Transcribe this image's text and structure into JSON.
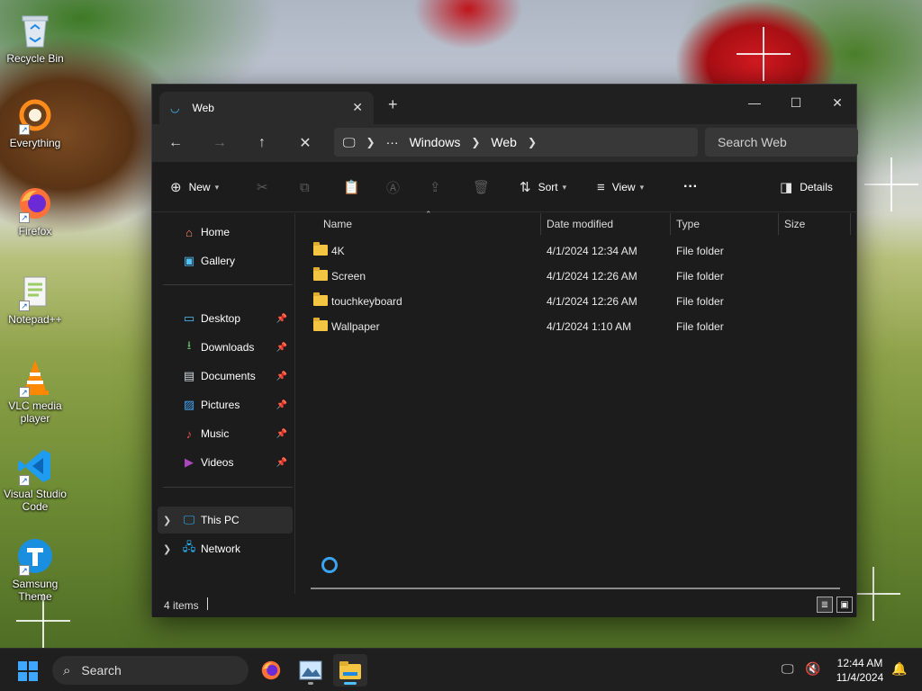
{
  "desktop": {
    "icons": [
      {
        "label": "Recycle Bin"
      },
      {
        "label": "Everything"
      },
      {
        "label": "Firefox"
      },
      {
        "label": "Notepad++"
      },
      {
        "label": "VLC media player"
      },
      {
        "label": "Visual Studio Code"
      },
      {
        "label": "Samsung Theme"
      }
    ]
  },
  "window": {
    "tab_title": "Web",
    "new_tab": "+",
    "controls": {
      "minimize": "—",
      "maximize": "☐",
      "close": "✕"
    },
    "address": {
      "more": "···",
      "crumbs": [
        "Windows",
        "Web"
      ]
    },
    "search": {
      "placeholder": "Search Web"
    },
    "commands": {
      "new": "New",
      "sort": "Sort",
      "view": "View",
      "more": "···",
      "details": "Details"
    },
    "sidebar": {
      "top": [
        {
          "label": "Home"
        },
        {
          "label": "Gallery"
        }
      ],
      "pinned": [
        {
          "label": "Desktop"
        },
        {
          "label": "Downloads"
        },
        {
          "label": "Documents"
        },
        {
          "label": "Pictures"
        },
        {
          "label": "Music"
        },
        {
          "label": "Videos"
        }
      ],
      "devices": [
        {
          "label": "This PC"
        },
        {
          "label": "Network"
        }
      ]
    },
    "columns": [
      "Name",
      "Date modified",
      "Type",
      "Size"
    ],
    "files": [
      {
        "name": "4K",
        "date": "4/1/2024 12:34 AM",
        "type": "File folder",
        "size": ""
      },
      {
        "name": "Screen",
        "date": "4/1/2024 12:26 AM",
        "type": "File folder",
        "size": ""
      },
      {
        "name": "touchkeyboard",
        "date": "4/1/2024 12:26 AM",
        "type": "File folder",
        "size": ""
      },
      {
        "name": "Wallpaper",
        "date": "4/1/2024 1:10 AM",
        "type": "File folder",
        "size": ""
      }
    ],
    "status": {
      "item_count": "4 items"
    }
  },
  "taskbar": {
    "search_label": "Search",
    "time": "12:44 AM",
    "date": "11/4/2024"
  },
  "colors": {
    "accent": "#4cc2ff",
    "folder": "#f4c542",
    "window_bg": "#1c1c1c"
  }
}
